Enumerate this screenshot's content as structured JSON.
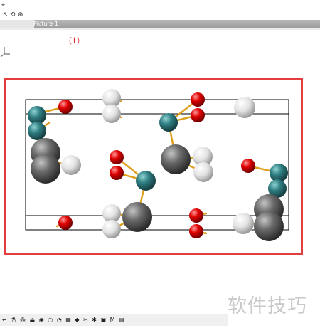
{
  "window": {
    "title": "Picture 1"
  },
  "top_toolbar": {
    "icons": [
      "app-icon",
      "select-icon",
      "rotate-icon",
      "zoom-icon"
    ]
  },
  "annotation": {
    "label": "（1）",
    "highlight_color": "#e23c3c"
  },
  "structure_colors": {
    "teal_atom": "#2f7e82",
    "red_atom": "#e00000",
    "gray_atom": "#6a6a6a",
    "white_atom": "#e8e8e8",
    "bond": "#e0a020",
    "cell_line": "#000000"
  },
  "bottom_toolbar": {
    "items": [
      "↩",
      "⚗",
      "⁂",
      "⏏",
      "◉",
      "○",
      "◔",
      "▦",
      "◆",
      "✂",
      "✱",
      "▣",
      "M",
      "▤"
    ]
  },
  "watermark": {
    "text": "软件技巧"
  }
}
